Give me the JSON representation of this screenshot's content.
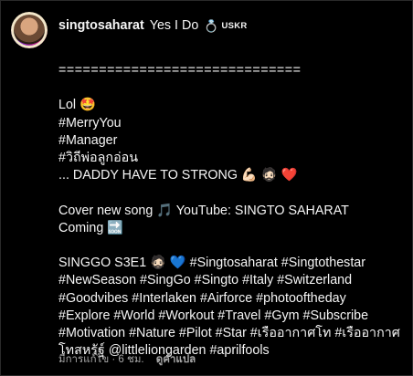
{
  "post": {
    "username": "singtosaharat",
    "title": "Yes I Do",
    "ring_icon": "ring-emoji",
    "tag": "USKR",
    "separator": "==============================",
    "lines": [
      "Lol 🤩",
      "#MerryYou",
      "#Manager",
      "#วิถีพ่อลูกอ่อน",
      "... DADDY HAVE TO STRONG 💪🏻 🧔🏻 ❤️"
    ],
    "cover_line": "Cover new song 🎵 YouTube: SINGTO SAHARAT",
    "coming_line": "Coming 🔜",
    "hashtag_lines": [
      "SINGGO S3E1 🧔🏻 💙 #Singtosaharat #Singtothestar",
      "#NewSeason #SingGo #Singto #Italy #Switzerland",
      "#Goodvibes #Interlaken #Airforce #photooftheday",
      "#Explore #World #Workout #Travel #Gym #Subscribe",
      "#Motivation #Nature #Pilot #Star #เรืออากาศโท #เรืออากาศ",
      "โทสหรัฐ์ @littleliongarden #aprilfools"
    ]
  },
  "footer": {
    "edited": "มีการแก้ไข · 6 ชม.",
    "translate": "ดูคำแปล"
  }
}
